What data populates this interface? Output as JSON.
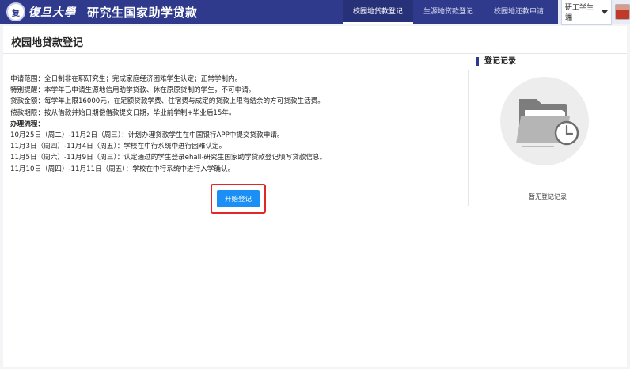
{
  "header": {
    "uni_name": "復旦大學",
    "system_title": "研究生国家助学贷款",
    "tabs": [
      {
        "label": "校园地贷款登记",
        "active": true
      },
      {
        "label": "生源地贷款登记",
        "active": false
      },
      {
        "label": "校园地还款申请",
        "active": false
      }
    ],
    "user_name": "研工学生端"
  },
  "page": {
    "title": "校园地贷款登记",
    "info_lines": [
      "申请范围：全日制非在职研究生；完成家庭经济困难学生认定；正常学制内。",
      "特别提醒：本学年已申请生源地信用助学贷款、休在原原贷制的学生，不可申请。",
      "贷款金额：每学年上限16000元，在足额贷款学费、住宿费与成定的贷款上限有结余的方可贷款生活费。",
      "偿款期限：按从借款并始日期偿借款提交日期，毕业前学制+毕业后15年。"
    ],
    "process_title": "办理流程：",
    "process_lines": [
      "10月25日（周二）-11月2日（周三）：计划办理贷款学生在中国银行APP中提交贷款申请。",
      "11月3日（周四）-11月4日（周五）：学校在中行系统中进行困难认定。",
      "11月5日（周六）-11月9日（周三）：认定通过的学生登录ehall-研究生国家助学贷款登记填写贷款信息。",
      "11月10日（周四）-11月11日（周五）：学校在中行系统中进行入学确认。"
    ],
    "start_button": "开始登记"
  },
  "records": {
    "title": "登记记录",
    "empty_text": "暂无登记记录"
  },
  "colors": {
    "header_bg": "#2f3a8c",
    "primary_button": "#1b8ff5",
    "highlight_border": "#e32626"
  }
}
